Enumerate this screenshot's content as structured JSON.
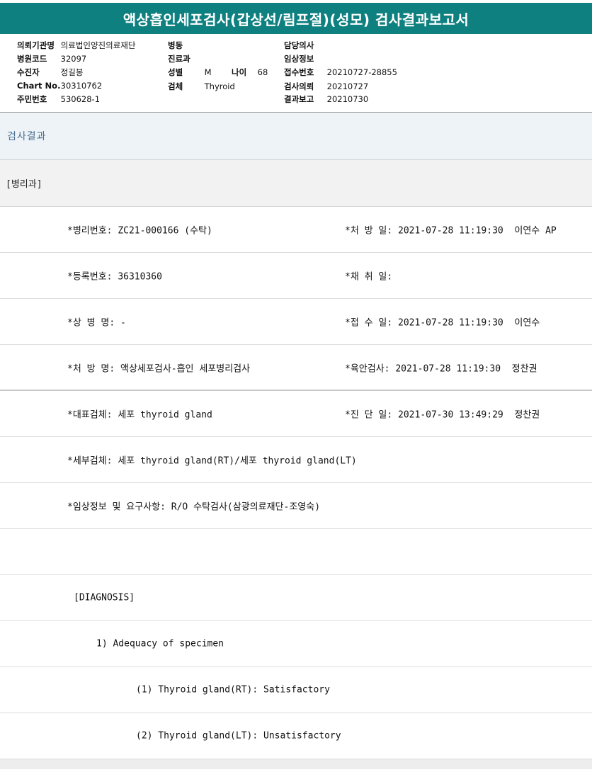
{
  "title": "액상흡인세포검사(갑상선/림프절)(성모) 검사결과보고서",
  "info": {
    "col1": [
      {
        "label": "의뢰기관명",
        "value": "의료법인양진의료재단"
      },
      {
        "label": "병원코드",
        "value": "32097"
      },
      {
        "label": "수진자",
        "value": "정길봉"
      },
      {
        "label": "Chart No.",
        "value": "30310762"
      },
      {
        "label": "주민번호",
        "value": "530628-1"
      }
    ],
    "col2": {
      "ward_label": "병동",
      "dept_label": "진료과",
      "sex_label": "성별",
      "sex_value": "M",
      "age_label": "나이",
      "age_value": "68",
      "specimen_label": "검체",
      "specimen_value": "Thyroid"
    },
    "col3": [
      {
        "label": "담당의사",
        "value": ""
      },
      {
        "label": "임상정보",
        "value": ""
      },
      {
        "label": "접수번호",
        "value": "20210727-28855"
      },
      {
        "label": "검사의뢰",
        "value": "20210727"
      },
      {
        "label": "결과보고",
        "value": "20210730"
      }
    ]
  },
  "section_title": "검사결과",
  "department": "[병리과]",
  "rows": [
    {
      "left": "*병리번호: ZC21-000166 (수탁)",
      "right": "*처 방 일: 2021-07-28 11:19:30  이연수 AP"
    },
    {
      "left": "*등록번호: 36310360",
      "right": "*채 취 일:"
    },
    {
      "left": "*상 병 명: -",
      "right": "*접 수 일: 2021-07-28 11:19:30  이연수"
    },
    {
      "left": "*처 방 명: 액상세포검사-흡인 세포병리검사",
      "right": "*육안검사: 2021-07-28 11:19:30  정찬권"
    },
    {
      "left": "*대표검체: 세포 thyroid gland",
      "right": "*진 단 일: 2021-07-30 13:49:29  정찬권"
    },
    {
      "left": "*세부검체: 세포 thyroid gland(RT)/세포 thyroid gland(LT)",
      "right": ""
    },
    {
      "left": "*임상정보 및 요구사항: R/O 수탁검사(삼광의료재단-조영숙)",
      "right": ""
    },
    {
      "left": "",
      "right": ""
    },
    {
      "left": "[DIAGNOSIS]",
      "right": ""
    },
    {
      "left": "1) Adequacy of specimen",
      "right": ""
    },
    {
      "left": "(1) Thyroid gland(RT): Satisfactory",
      "right": ""
    },
    {
      "left": "(2) Thyroid gland(LT): Unsatisfactory",
      "right": ""
    }
  ]
}
